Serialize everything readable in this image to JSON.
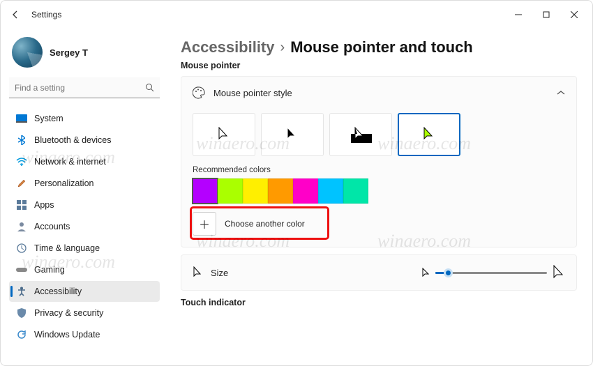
{
  "window": {
    "title": "Settings"
  },
  "user": {
    "name": "Sergey T"
  },
  "search": {
    "placeholder": "Find a setting"
  },
  "nav": {
    "items": [
      {
        "label": "System"
      },
      {
        "label": "Bluetooth & devices"
      },
      {
        "label": "Network & internet"
      },
      {
        "label": "Personalization"
      },
      {
        "label": "Apps"
      },
      {
        "label": "Accounts"
      },
      {
        "label": "Time & language"
      },
      {
        "label": "Gaming"
      },
      {
        "label": "Accessibility"
      },
      {
        "label": "Privacy & security"
      },
      {
        "label": "Windows Update"
      }
    ],
    "selected_index": 8
  },
  "breadcrumb": {
    "parent": "Accessibility",
    "current": "Mouse pointer and touch"
  },
  "sections": {
    "mouse_pointer": "Mouse pointer",
    "touch_indicator": "Touch indicator"
  },
  "pointer_style": {
    "label": "Mouse pointer style",
    "selected_index": 3
  },
  "recommended_colors": {
    "label": "Recommended colors",
    "colors": [
      "#b400ff",
      "#aaff00",
      "#ffef00",
      "#ff9a00",
      "#ff00c8",
      "#00c3ff",
      "#00e6a8"
    ],
    "selected_index": 0
  },
  "choose_another": {
    "label": "Choose another color"
  },
  "size": {
    "label": "Size"
  },
  "watermark": "winaero.com"
}
